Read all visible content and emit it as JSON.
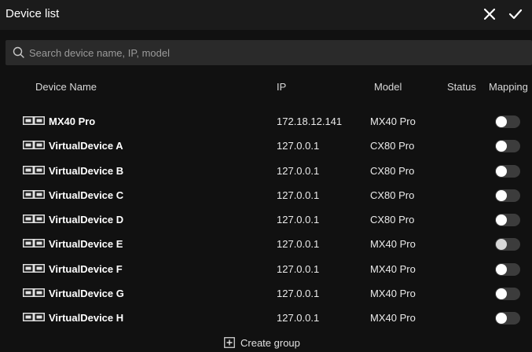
{
  "window": {
    "title": "Device list"
  },
  "search": {
    "placeholder": "Search device name, IP, model"
  },
  "table": {
    "headers": {
      "name": "Device Name",
      "ip": "IP",
      "model": "Model",
      "status": "Status",
      "mapping": "Mapping"
    },
    "rows": [
      {
        "name": "MX40 Pro",
        "ip": "172.18.12.141",
        "model": "MX40 Pro",
        "mapping": false
      },
      {
        "name": "VirtualDevice A",
        "ip": "127.0.0.1",
        "model": "CX80 Pro",
        "mapping": false
      },
      {
        "name": "VirtualDevice B",
        "ip": "127.0.0.1",
        "model": "CX80 Pro",
        "mapping": false
      },
      {
        "name": "VirtualDevice C",
        "ip": "127.0.0.1",
        "model": "CX80 Pro",
        "mapping": false
      },
      {
        "name": "VirtualDevice D",
        "ip": "127.0.0.1",
        "model": "CX80 Pro",
        "mapping": false
      },
      {
        "name": "VirtualDevice E",
        "ip": "127.0.0.1",
        "model": "MX40 Pro",
        "mapping": false
      },
      {
        "name": "VirtualDevice F",
        "ip": "127.0.0.1",
        "model": "MX40 Pro",
        "mapping": false
      },
      {
        "name": "VirtualDevice G",
        "ip": "127.0.0.1",
        "model": "MX40 Pro",
        "mapping": false
      },
      {
        "name": "VirtualDevice H",
        "ip": "127.0.0.1",
        "model": "MX40 Pro",
        "mapping": false
      }
    ]
  },
  "footer": {
    "create_group_label": "Create group"
  },
  "colors": {
    "background": "#111111",
    "titlebar": "#1b1b1b",
    "search_bg": "#2a2a2a",
    "toggle_track": "#3c3c3c",
    "toggle_knob": "#ffffff"
  },
  "icons": {
    "close": "close-icon",
    "confirm": "check-icon",
    "search": "search-icon",
    "device": "device-icon",
    "create_group": "plus-square-icon"
  }
}
